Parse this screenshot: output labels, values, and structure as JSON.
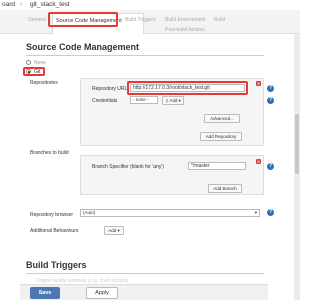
{
  "breadcrumb": {
    "prefix": "oard",
    "separator": "›",
    "job": "git_stack_test"
  },
  "tabs": [
    {
      "label": "General"
    },
    {
      "label": "Source Code Management"
    },
    {
      "label": "Build Triggers"
    },
    {
      "label": "Build Environment"
    },
    {
      "label": "Build"
    },
    {
      "label": "Post-build Actions"
    }
  ],
  "scm": {
    "title": "Source Code Management",
    "option_none": "None",
    "option_git": "Git",
    "repositories_label": "Repositories",
    "repo_url_label": "Repository URL",
    "repo_url_value": "http://172.17.0.3/root/stack_test.git",
    "credentials_label": "Credentials",
    "credentials_value": "- none -",
    "add_button": "Add",
    "advanced_button": "Advanced...",
    "add_repository_button": "Add Repository",
    "branches_label": "Branches to build",
    "branch_specifier_label": "Branch Specifier (blank for 'any')",
    "branch_specifier_value": "*/master",
    "add_branch_button": "Add Branch",
    "repo_browser_label": "Repository browser",
    "repo_browser_value": "(Auto)",
    "additional_behaviours_label": "Additional Behaviours",
    "additional_add_button": "Add"
  },
  "build_triggers": {
    "title": "Build Triggers",
    "faint_option": "Trigger builds remotely (e.g., from scripts)"
  },
  "footer": {
    "save": "Save",
    "apply": "Apply"
  },
  "icons": {
    "help": "help-icon",
    "delete": "delete-icon",
    "dropdown": "chevron-down-icon"
  },
  "colors": {
    "highlight": "#e53935",
    "save_button": "#4b78b3",
    "help_icon": "#2f6fb6"
  }
}
